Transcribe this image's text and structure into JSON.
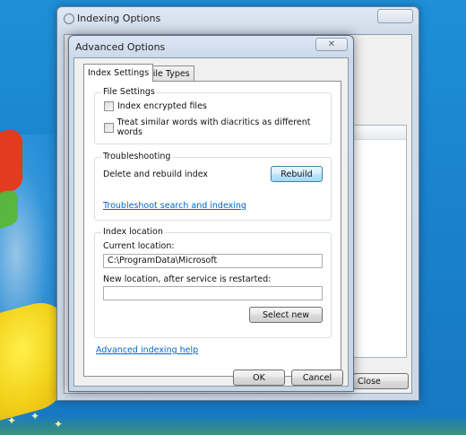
{
  "back_window": {
    "title": "Indexing Options",
    "close_label": "Close"
  },
  "dialog": {
    "title": "Advanced Options",
    "close_glyph": "✕",
    "tabs": [
      {
        "label": "Index Settings",
        "active": true
      },
      {
        "label": "File Types",
        "active": false
      }
    ],
    "file_settings": {
      "legend": "File Settings",
      "options": [
        {
          "label": "Index encrypted files",
          "checked": false
        },
        {
          "label": "Treat similar words with diacritics as different words",
          "checked": false
        }
      ]
    },
    "troubleshooting": {
      "legend": "Troubleshooting",
      "rebuild_text": "Delete and rebuild index",
      "rebuild_button": "Rebuild",
      "troubleshoot_link": "Troubleshoot search and indexing"
    },
    "index_location": {
      "legend": "Index location",
      "current_label": "Current location:",
      "current_value": "C:\\ProgramData\\Microsoft",
      "new_label": "New location, after service is restarted:",
      "new_value": "",
      "select_button": "Select new"
    },
    "help_link": "Advanced indexing help",
    "ok_button": "OK",
    "cancel_button": "Cancel"
  },
  "colors": {
    "desktop": "#1a84cf",
    "link": "#0066cc",
    "dialog_frame": "#cbd8e8"
  }
}
